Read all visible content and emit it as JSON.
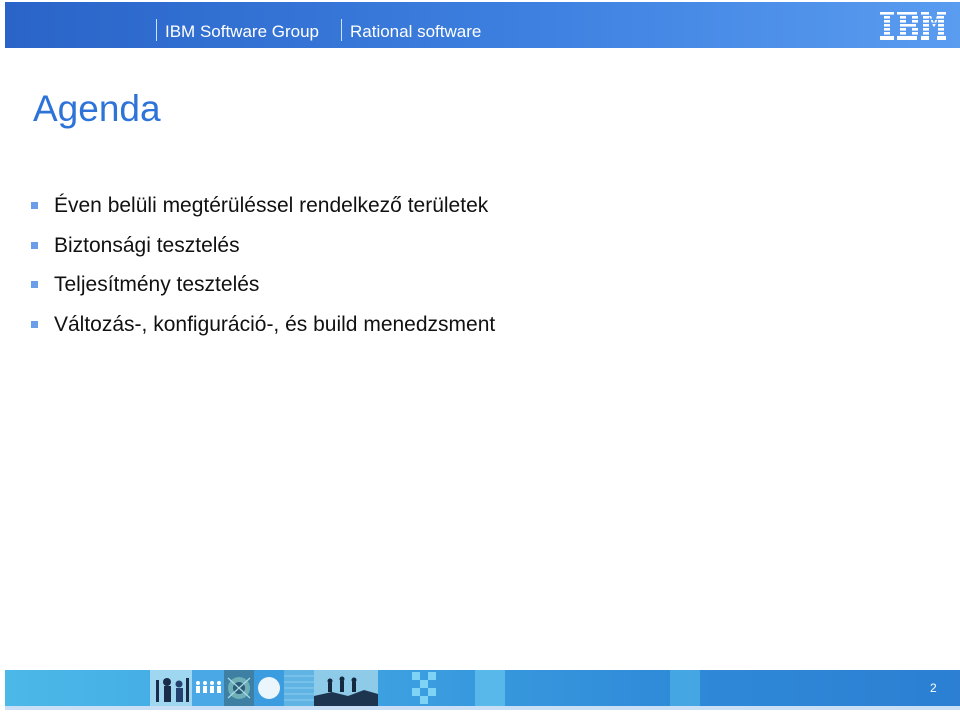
{
  "header": {
    "group": "IBM Software Group",
    "separator": "|",
    "subtitle": "Rational software",
    "logo": "IBM",
    "colors": {
      "bar": "#2a64c8",
      "text": "#ffffff"
    }
  },
  "slide": {
    "title": "Agenda",
    "bullets": [
      "Éven belüli megtérüléssel rendelkező területek",
      "Biztonsági tesztelés",
      "Teljesítmény tesztelés",
      "Változás-, konfiguráció-, és build menedzsment"
    ],
    "colors": {
      "title": "#2d73d8",
      "bullet_marker": "#6a9ee8",
      "text": "#111111"
    }
  },
  "footer": {
    "page_number": "2",
    "colors": {
      "bar": "#3ea4e2"
    },
    "images": [
      "people-photo",
      "figures-icon",
      "circuit-photo",
      "circle-icon",
      "texture",
      "climbers-photo",
      "pixel-pattern"
    ]
  }
}
